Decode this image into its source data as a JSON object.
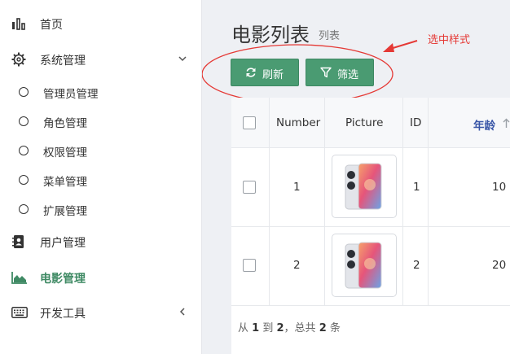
{
  "sidebar": {
    "items": [
      {
        "label": "首页",
        "icon": "bar-chart-icon"
      },
      {
        "label": "系统管理",
        "icon": "gear-icon",
        "expand": "chevron-down-icon"
      },
      {
        "label": "管理员管理",
        "icon": "circle-icon"
      },
      {
        "label": "角色管理",
        "icon": "circle-icon"
      },
      {
        "label": "权限管理",
        "icon": "circle-icon"
      },
      {
        "label": "菜单管理",
        "icon": "circle-icon"
      },
      {
        "label": "扩展管理",
        "icon": "circle-icon"
      },
      {
        "label": "用户管理",
        "icon": "address-book-icon"
      },
      {
        "label": "电影管理",
        "icon": "area-chart-icon",
        "active": true
      },
      {
        "label": "开发工具",
        "icon": "keyboard-icon",
        "expand": "chevron-left-icon"
      }
    ],
    "active_color": "#3f8a64"
  },
  "header": {
    "title": "电影列表",
    "subtitle": "列表"
  },
  "annotation": {
    "text": "选中样式",
    "color": "#e53935"
  },
  "toolbar": {
    "refresh_label": "刷新",
    "filter_label": "筛选",
    "button_color": "#4a9b72"
  },
  "table": {
    "columns": [
      "Number",
      "Picture",
      "ID",
      "年龄"
    ],
    "sorted_column_color": "#3a57a8",
    "rows": [
      {
        "number": "1",
        "id": "1",
        "age": "10",
        "picture": "phone-image"
      },
      {
        "number": "2",
        "id": "2",
        "age": "20",
        "picture": "phone-image"
      }
    ]
  },
  "pagination": {
    "prefix": "从",
    "from": "1",
    "to_word": "到",
    "to": "2",
    "total_prefix": "，总共",
    "total": "2",
    "unit": "条"
  }
}
